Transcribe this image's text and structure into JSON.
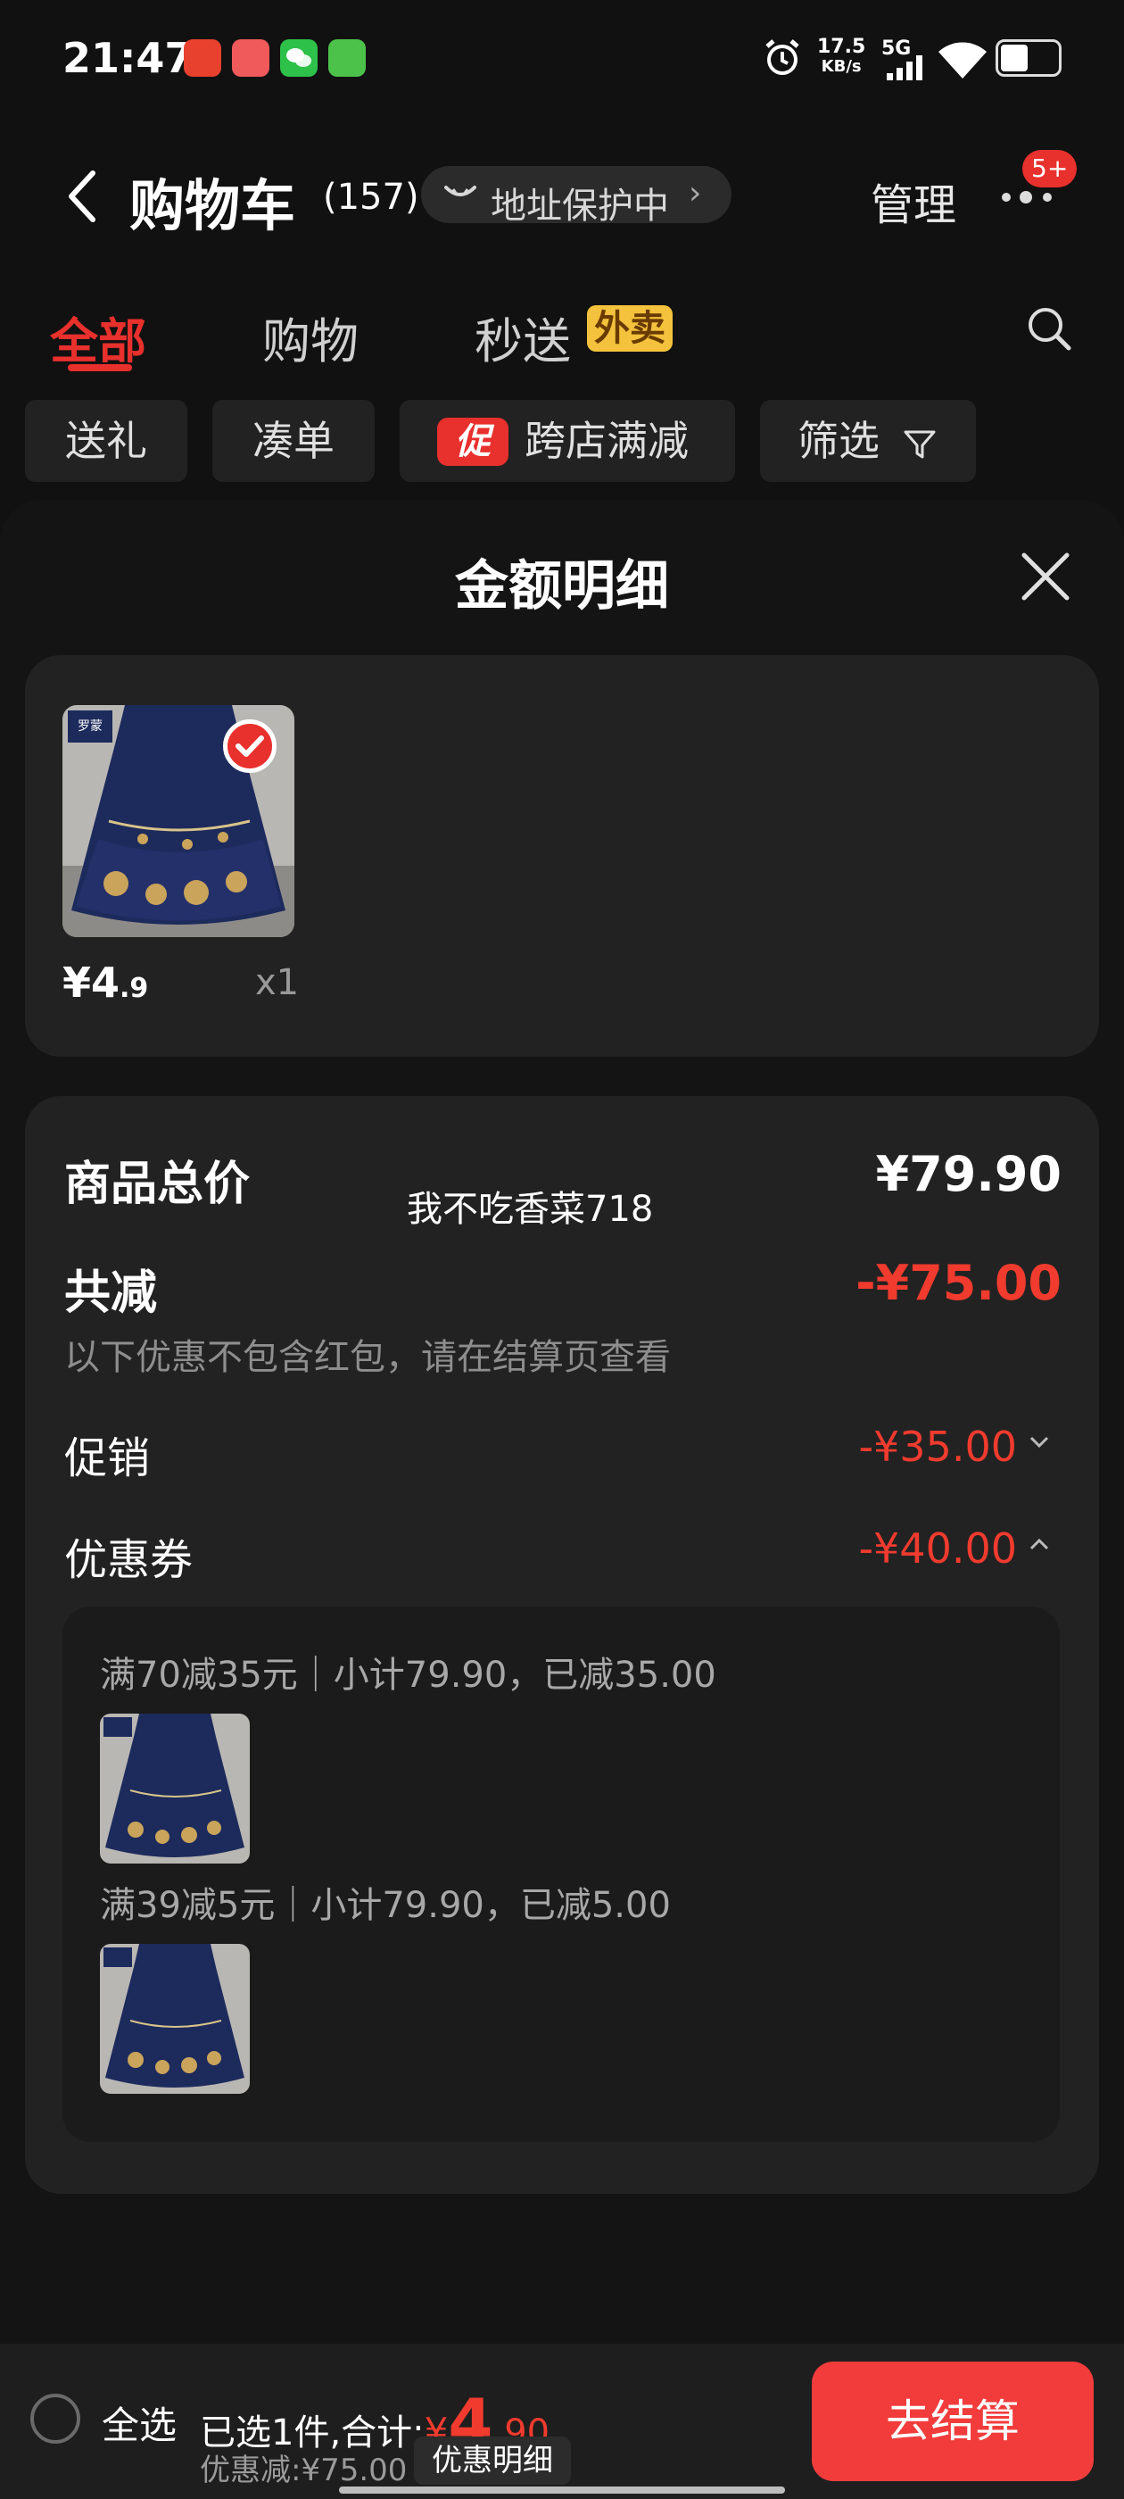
{
  "status_bar": {
    "time": "21:47",
    "network_speed_value": "17.5",
    "network_speed_unit": "KB/s",
    "signal": "5G",
    "app_icons": [
      "app-icon-red",
      "app-icon-game",
      "wechat-icon",
      "app-icon-green"
    ]
  },
  "header": {
    "title": "购物车",
    "count": "(157)",
    "address_protection": "地址保护中",
    "manage": "管理",
    "more_badge": "5+"
  },
  "tabs": [
    {
      "label": "全部",
      "active": true
    },
    {
      "label": "购物",
      "active": false
    },
    {
      "label": "秒送",
      "badge": "外卖",
      "active": false
    }
  ],
  "filters": {
    "gift": "送礼",
    "combine": "凑单",
    "promo_badge": "促",
    "cross_store": "跨店满减",
    "filter": "筛选"
  },
  "sheet": {
    "title": "金额明细"
  },
  "product": {
    "price_int": "¥4",
    "price_dec": ".9",
    "quantity": "x1",
    "brand": "罗蒙"
  },
  "summary": {
    "total_label": "商品总价",
    "total_value": "¥79.90",
    "watermark": "我不吃香菜718",
    "discount_label": "共减",
    "discount_value": "-¥75.00",
    "discount_note": "以下优惠不包含红包，请在结算页查看",
    "promo_label": "促销",
    "promo_value": "-¥35.00",
    "coupon_label": "优惠券",
    "coupon_value": "-¥40.00"
  },
  "coupon_details": [
    {
      "text": "满70减35元｜小计79.90，已减35.00"
    },
    {
      "text": "满39减5元｜小计79.90，已减5.00"
    }
  ],
  "bottom_bar": {
    "select_all": "全选",
    "selected_prefix": "已选1件,合计:",
    "total_yuan": "¥",
    "total_int": "4",
    "total_dec": ".90",
    "saved": "优惠减:¥75.00",
    "detail_tag": "优惠明细",
    "checkout": "去结算"
  },
  "colors": {
    "accent_red": "#e8302d",
    "takeout_yellow": "#f4c23c",
    "background": "#111111",
    "card": "#222222"
  }
}
